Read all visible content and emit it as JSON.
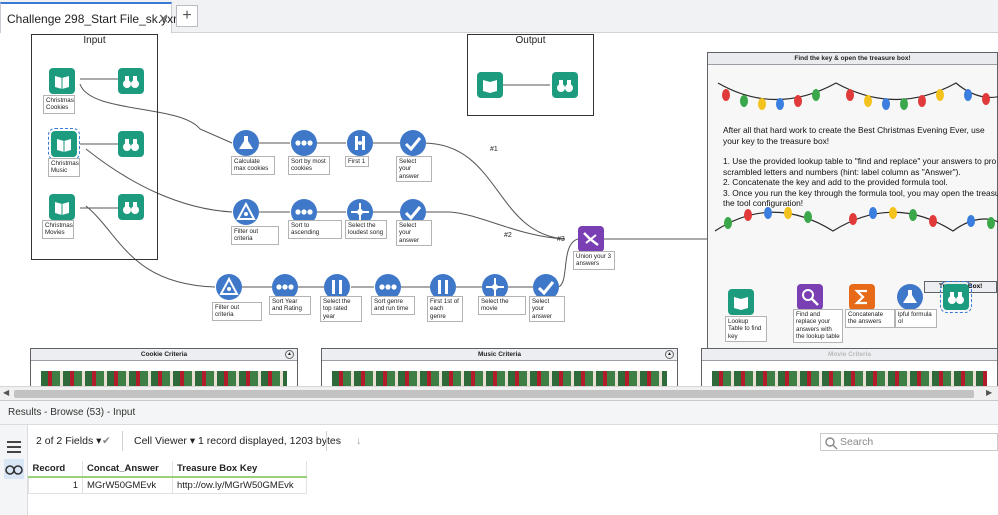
{
  "tab": {
    "title": "Challenge 298_Start File_sk.yxmd",
    "close": "✕",
    "add": "+"
  },
  "containers": {
    "input": "Input",
    "output": "Output",
    "lookup_panel": "Find the key & open the treasure box!",
    "treasure_box": "Treasure Box!",
    "cookie_criteria": "Cookie Criteria",
    "music_criteria": "Music Criteria",
    "movie_criteria": "Movie Criteria"
  },
  "panel_text": {
    "p1": "After all that hard work to create the Best Christmas Evening Ever, use your key to the treasure box!",
    "p2": "1. Use the provided lookup table to \"find and replace\"  your answers to pro scrambled letters and numbers (hint: label column as \"Answer\").",
    "p3": "2. Concatenate the key and add to the provided formula tool.",
    "p4": "3. Once you run the key through the formula tool, you may open the treasu the tool configuration!"
  },
  "annotations": {
    "christmas_cookies": "Christmas Cookies",
    "christmas_music": "Christmas Music",
    "christmas_movies": "Christmas Movies",
    "calc_max": "Calculate max cookies",
    "sort_most": "Sort by most cookies",
    "first1": "First 1",
    "select_answer1": "Select your answer",
    "filter1": "Filter out criteria",
    "sort_asc": "Sort to ascending",
    "select_loudest": "Select the loudest song",
    "select_answer2": "Select your answer",
    "filter2": "Filter out criteria",
    "sort_year": "Sort Year and Rating",
    "select_top": "Select the top rated year",
    "sort_genre": "Sort genre and run time",
    "first_genre": "First 1st of each genre",
    "select_movie": "Select the movie",
    "select_answer3": "Select your answer",
    "union": "Union your 3 answers",
    "lookup_table": "Lookup Table to find key",
    "find_replace": "Find and replace your answers with the lookup table",
    "concat": "Concatenate the answers",
    "helpful_formula": "lpful formula ol"
  },
  "connection_labels": {
    "c1": "#1",
    "c2": "#2",
    "c3": "#3"
  },
  "results": {
    "header": "Results - Browse (53) - Input",
    "fields": "2 of 2 Fields",
    "cell_viewer": "Cell Viewer",
    "records": "1 record displayed, 1203 bytes",
    "search_placeholder": "Search",
    "columns": [
      "Record",
      "Concat_Answer",
      "Treasure Box Key"
    ],
    "rows": [
      {
        "record": "1",
        "concat": "MGrW50GMEvk",
        "key": "http://ow.ly/MGrW50GMEvk"
      }
    ]
  },
  "icons": {
    "input": "book-icon",
    "browse": "binoculars-icon",
    "formula": "flask-icon",
    "sort": "sort-dots-icon",
    "sample": "sample-icon",
    "select": "checkmark-icon",
    "filter": "filter-triangle-icon",
    "union": "union-icon",
    "find_replace": "find-replace-icon",
    "summarize": "sigma-icon",
    "settings": "settings-icon"
  },
  "colors": {
    "input_tool": "#1c9b7e",
    "prep_tool": "#3f78c9",
    "join_tool": "#7a3fb3",
    "transform_tool": "#e66a18",
    "accent": "#3b7ad4"
  }
}
